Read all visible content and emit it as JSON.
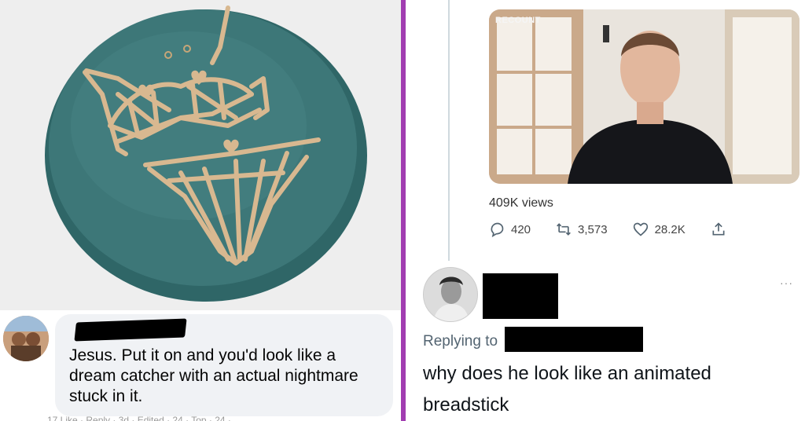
{
  "left_panel": {
    "comment": {
      "text": "Jesus.  Put it on and you'd look like a dream catcher with an actual nightmare stuck in it.",
      "cutoff": "17 Like · Reply · 3d · Edited · 24 · Top · 24 ·"
    }
  },
  "right_panel": {
    "video": {
      "logo": "RECOUNT"
    },
    "views": "409K views",
    "actions": {
      "replies": "420",
      "retweets": "3,573",
      "likes": "28.2K"
    },
    "more": "···",
    "replying_to_label": "Replying to",
    "tweet_text": "why does he look like an animated breadstick"
  },
  "colors": {
    "divider": "#a13db1",
    "bubble": "#f0f2f5",
    "cushion": "#3d7778",
    "straps": "#d8b890"
  }
}
